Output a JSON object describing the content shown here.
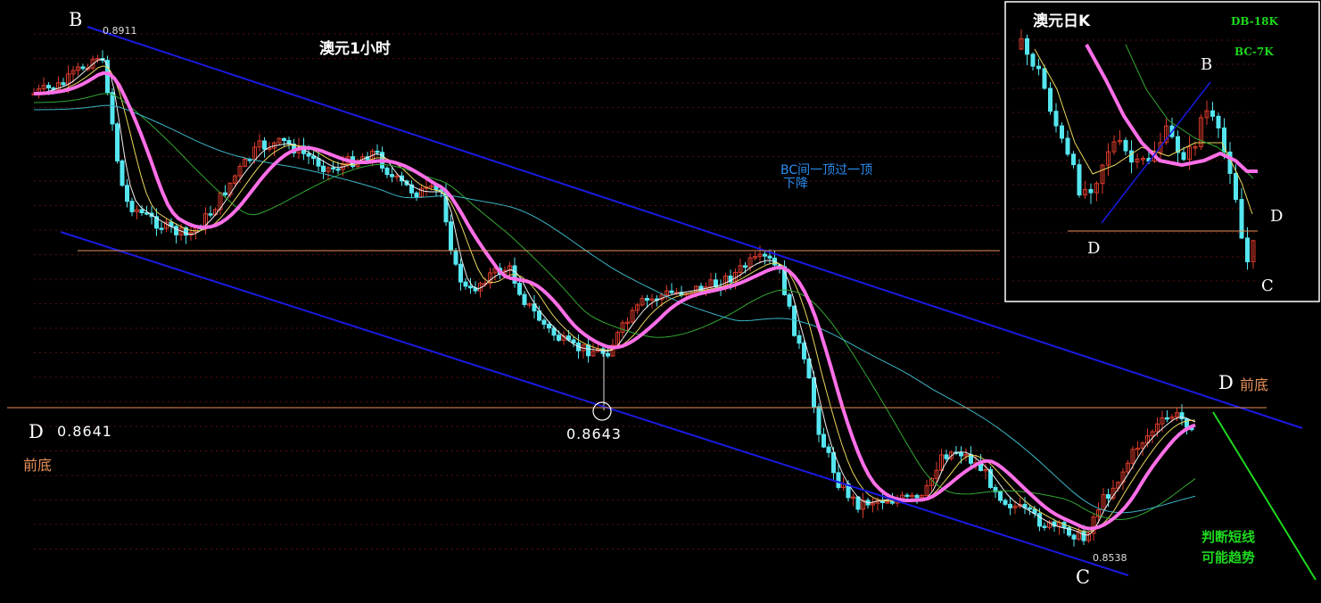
{
  "main_chart": {
    "title": "澳元1小时",
    "high_value": "0.8911",
    "low_value": "0.8538",
    "point_labels": {
      "B": "B",
      "C": "C",
      "D": "D"
    },
    "left_d_value": "0.8641",
    "left_prior_bottom": "前底",
    "touch_value": "0.8643",
    "right_d_label": "前底",
    "note_line1": "BC间一顶过一顶",
    "note_line2": "下降",
    "forecast_line1": "判断短线",
    "forecast_line2": "可能趋势"
  },
  "inset_chart": {
    "title": "澳元日K",
    "legend_db": "DB-18K",
    "legend_bc": "BC-7K",
    "point_labels": {
      "B": "B",
      "C": "C",
      "D1": "D",
      "D2": "D"
    }
  },
  "colors": {
    "background": "#000000",
    "bull": "#d93a2b",
    "bear": "#55e6f0",
    "channel": "#1a1ae0",
    "ma_thick": "#ff6fe8",
    "ma_yellow": "#e8d65a",
    "ma_white": "#f0f0f0",
    "ma_green": "#33a833",
    "ma_cyan": "#3bb6c8",
    "support": "#e8905a",
    "forecast": "#1ed81e",
    "note": "#2a8cf0"
  },
  "chart_data": [
    {
      "type": "candlestick",
      "title": "澳元1小时",
      "y_min": 0.8538,
      "y_max": 0.8911,
      "annotations": [
        "B 0.8911",
        "C 0.8538",
        "D 0.8641",
        "0.8643",
        "前底",
        "BC间一顶过一顶 下降",
        "判断短线 可能趋势"
      ]
    },
    {
      "type": "candlestick",
      "title": "澳元日K",
      "legend": [
        "DB-18K",
        "BC-7K"
      ],
      "annotations": [
        "B",
        "C",
        "D",
        "D"
      ]
    }
  ]
}
